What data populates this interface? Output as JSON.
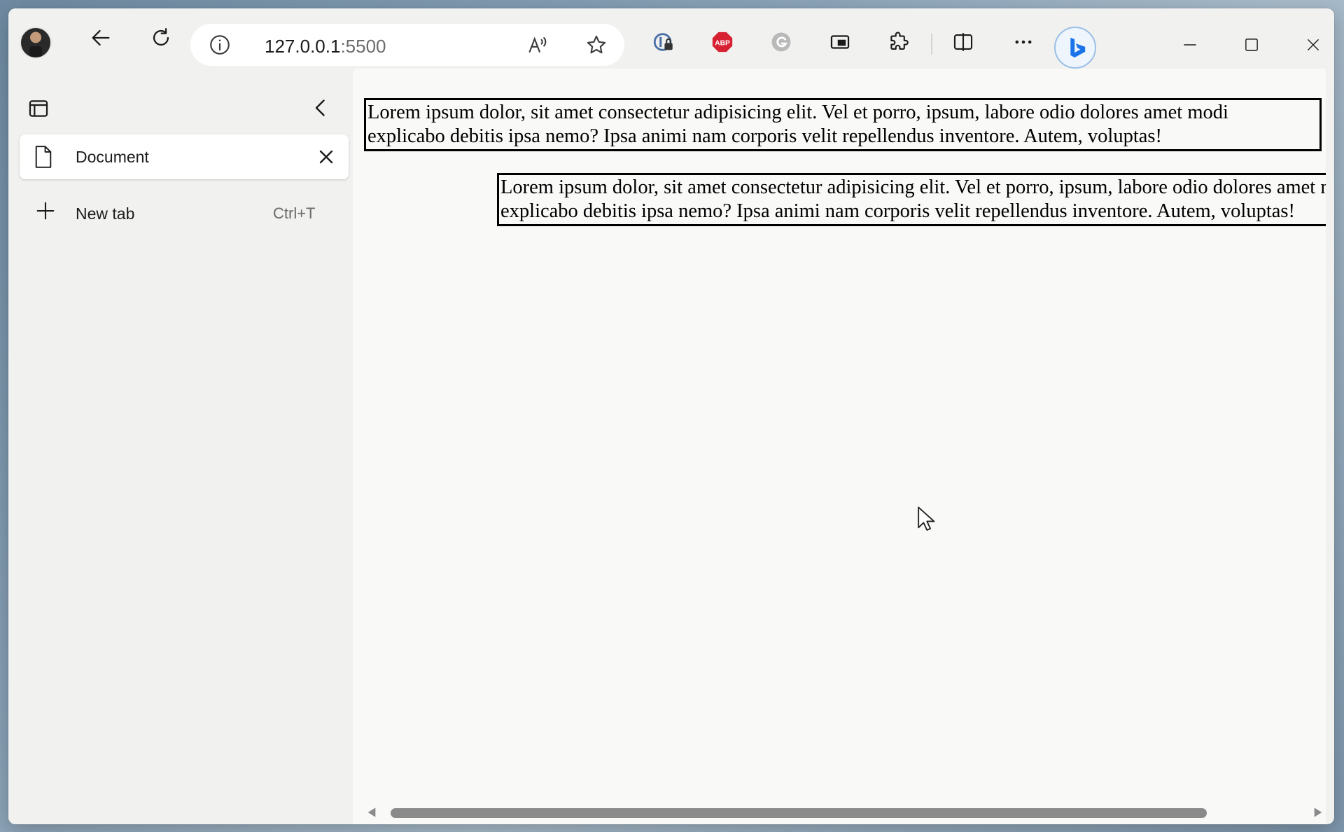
{
  "browser": {
    "address": {
      "host": "127.0.0.1",
      "port": ":5500"
    },
    "toolbar": {
      "back": "back-arrow-icon",
      "refresh": "refresh-icon",
      "site_info": "info-icon",
      "read_aloud": "read-aloud-icon",
      "favorite": "star-icon"
    },
    "extensions": [
      "password-manager-icon",
      "adblock-plus-icon",
      "grammarly-icon",
      "picture-in-picture-icon",
      "extensions-puzzle-icon",
      "split-screen-icon",
      "more-menu-icon",
      "bing-chat-icon"
    ],
    "adblock_label": "ABP"
  },
  "sidebar": {
    "tabs": [
      {
        "title": "Document"
      }
    ],
    "new_tab": {
      "label": "New tab",
      "shortcut": "Ctrl+T"
    }
  },
  "page": {
    "paragraph1": {
      "line1": "Lorem ipsum dolor, sit amet consectetur adipisicing elit. Vel et porro, ipsum, labore odio dolores amet modi",
      "line2": "explicabo debitis ipsa nemo? Ipsa animi nam corporis velit repellendus inventore. Autem, voluptas!"
    },
    "paragraph2": {
      "line1": "Lorem ipsum dolor, sit amet consectetur adipisicing elit. Vel et porro, ipsum, labore odio dolores amet modi",
      "line2": "explicabo debitis ipsa nemo? Ipsa animi nam corporis velit repellendus inventore. Autem, voluptas!"
    }
  },
  "colors": {
    "window_bg": "#f1f1f0",
    "content_bg": "#f9f9f8",
    "adblock_red": "#d72032",
    "bing_blue": "#1a73e8"
  }
}
